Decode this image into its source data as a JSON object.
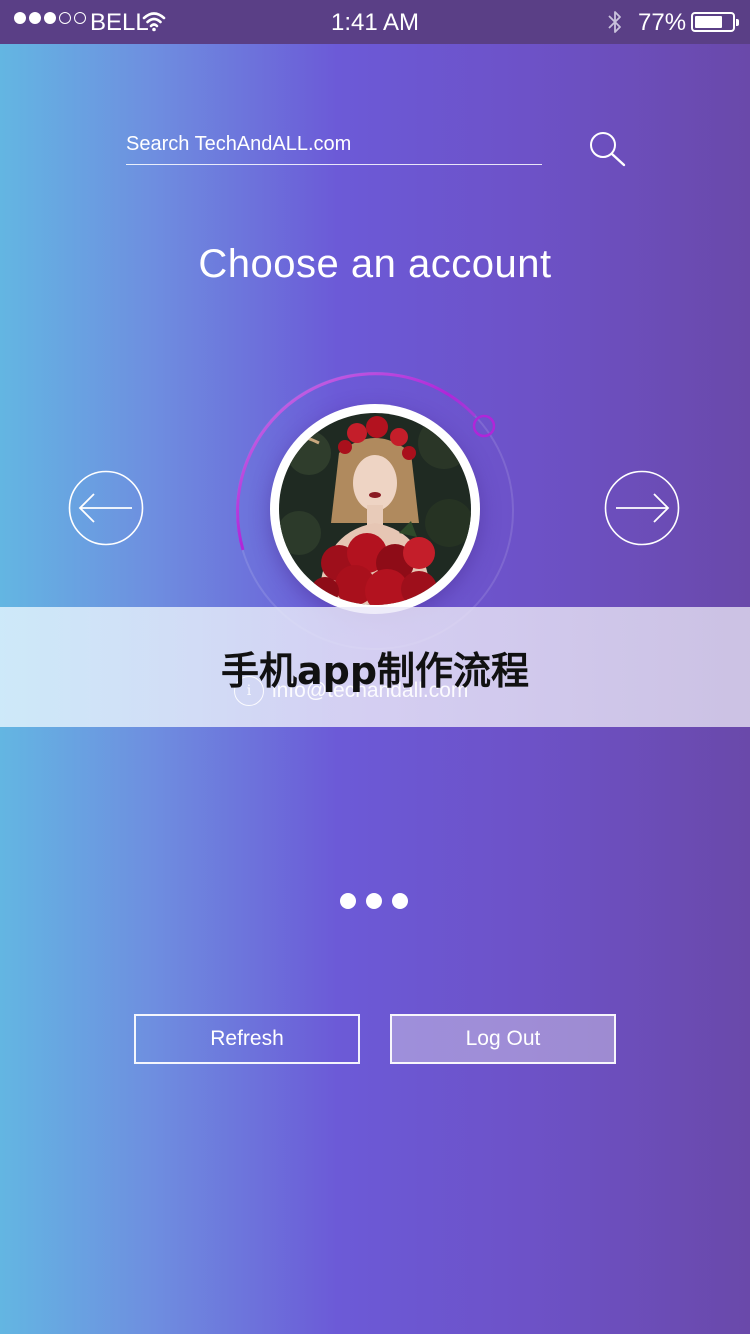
{
  "status_bar": {
    "carrier": "BELL",
    "time": "1:41 AM",
    "battery_percent_text": "77%",
    "battery_level": 0.77,
    "signal_strength_dots_filled": 3,
    "signal_strength_dots_total": 5
  },
  "search": {
    "placeholder": "Search TechAndALL.com",
    "icon": "search-icon"
  },
  "title": "Choose an account",
  "carousel": {
    "prev_icon": "arrow-left-icon",
    "next_icon": "arrow-right-icon",
    "avatar_icon": "avatar-photo"
  },
  "account": {
    "email": "info@techandall.com",
    "info_glyph": "i"
  },
  "banner_text": "手机app制作流程",
  "pagination": {
    "count": 3
  },
  "buttons": {
    "refresh_label": "Refresh",
    "logout_label": "Log Out"
  },
  "colors": {
    "status_bar": "#5a3f86",
    "gradient_left": "#63b6e2",
    "gradient_mid": "#6c5ad7",
    "gradient_right": "#6a49aa",
    "ring_accent": "#b026d8"
  }
}
